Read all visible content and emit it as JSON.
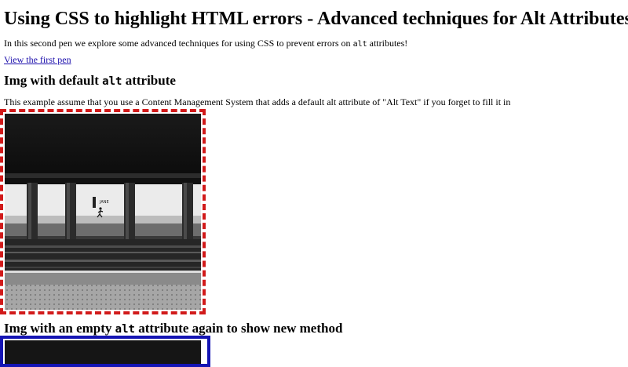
{
  "page": {
    "title": "Using CSS to highlight HTML errors - Advanced techniques for Alt Attributes",
    "intro_before": "In this second pen we explore some advanced techniques for using CSS to prevent errors on ",
    "intro_code": "alt",
    "intro_after": " attributes!",
    "first_pen_link": "View the first pen"
  },
  "section1": {
    "heading_before": "Img with default ",
    "heading_code": "alt",
    "heading_after": " attribute",
    "description": "This example assume that you use a Content Management System that adds a default alt attribute of \"Alt Text\" if you forget to fill it in",
    "image_sign_text": "JANE",
    "border_color": "#d11a1a"
  },
  "section2": {
    "heading_before": "Img with an empty ",
    "heading_code": "alt",
    "heading_after": " attribute again to show new method",
    "border_color": "#1414b4"
  }
}
